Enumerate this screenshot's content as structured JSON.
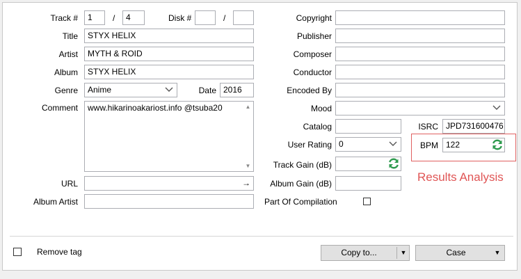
{
  "left": {
    "track_label": "Track #",
    "track_value": "1",
    "track_sep": "/",
    "track_total": "4",
    "disk_label": "Disk #",
    "disk_value": "",
    "disk_sep": "/",
    "disk_total": "",
    "title_label": "Title",
    "title_value": "STYX HELIX",
    "artist_label": "Artist",
    "artist_value": "MYTH & ROID",
    "album_label": "Album",
    "album_value": "STYX HELIX",
    "genre_label": "Genre",
    "genre_value": "Anime",
    "date_label": "Date",
    "date_value": "2016",
    "comment_label": "Comment",
    "comment_value": "www.hikarinoakariost.info @tsuba20",
    "url_label": "URL",
    "url_value": "",
    "url_arrow": "→",
    "album_artist_label": "Album Artist",
    "album_artist_value": ""
  },
  "right": {
    "copyright_label": "Copyright",
    "copyright_value": "",
    "publisher_label": "Publisher",
    "publisher_value": "",
    "composer_label": "Composer",
    "composer_value": "",
    "conductor_label": "Conductor",
    "conductor_value": "",
    "encoded_by_label": "Encoded By",
    "encoded_by_value": "",
    "mood_label": "Mood",
    "mood_value": "",
    "catalog_label": "Catalog",
    "catalog_value": "",
    "isrc_label": "ISRC",
    "isrc_value": "JPD731600476",
    "user_rating_label": "User Rating",
    "user_rating_value": "0",
    "bpm_label": "BPM",
    "bpm_value": "122",
    "track_gain_label": "Track Gain (dB)",
    "track_gain_value": "",
    "album_gain_label": "Album Gain (dB)",
    "album_gain_value": "",
    "compilation_label": "Part Of Compilation"
  },
  "annotation": {
    "text": "Results Analysis",
    "color": "#e05555"
  },
  "footer": {
    "remove_tag_label": "Remove tag",
    "copy_to_label": "Copy to...",
    "case_label": "Case"
  },
  "colors": {
    "refresh_green": "#2e9a4e"
  },
  "icons": {
    "dropdown": "chevron-down-icon",
    "refresh": "refresh-icon",
    "url_go": "arrow-right-icon"
  }
}
